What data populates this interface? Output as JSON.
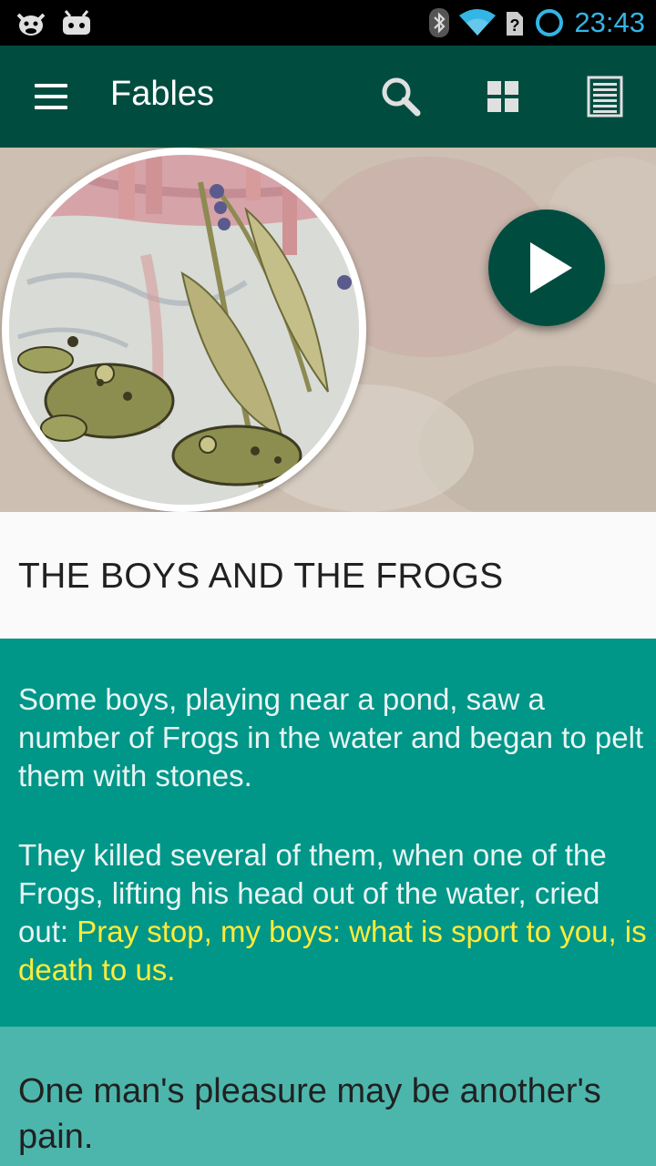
{
  "status_bar": {
    "time": "23:43",
    "left_icons": [
      "cyanogen-mascot-icon",
      "android-debug-icon"
    ],
    "right_icons": [
      "bluetooth-icon",
      "wifi-icon",
      "no-sim-icon",
      "sync-circle-icon"
    ],
    "accent_color": "#33b5e5"
  },
  "toolbar": {
    "title": "Fables",
    "actions": [
      "search-icon",
      "grid-view-icon",
      "list-view-icon"
    ],
    "background": "#004d40"
  },
  "hero": {
    "image": "boys-and-frogs-illustration",
    "play_icon": "play-icon"
  },
  "fable": {
    "title": "THE BOYS AND THE FROGS",
    "paragraph1": "Some boys, playing near a pond, saw a number of Frogs in the water and began to pelt them with stones.",
    "paragraph2_lead": "They killed several of them, when one of the Frogs, lifting his head out of the water, cried out: ",
    "paragraph2_quote": "Pray stop, my boys: what is sport to you, is death to us.",
    "moral": "One man's pleasure may be another's pain."
  },
  "colors": {
    "story_bg": "#009688",
    "moral_bg": "#4db6ac",
    "quote": "#ffeb3b"
  }
}
